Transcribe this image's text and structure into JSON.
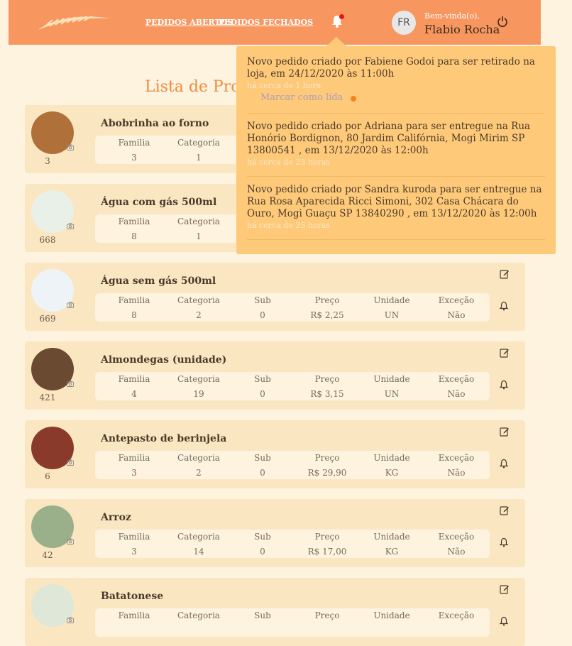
{
  "header": {
    "nav_open": "PEDIDOS ABERTOS",
    "nav_closed": "PEDIDOS FECHADOS",
    "avatar_initials": "FR",
    "welcome": "Bem-vinda(o),",
    "user_name": "Flabio Rocha"
  },
  "page": {
    "title": "Lista de Produtos"
  },
  "attr_labels": {
    "family": "Familia",
    "category": "Categoria",
    "sub": "Sub",
    "price": "Preço",
    "unit": "Unidade",
    "exception": "Exceção"
  },
  "products": [
    {
      "id": "3",
      "name": "Abobrinha ao forno",
      "family": "3",
      "category": "1",
      "sub": "",
      "price": "",
      "unit": "",
      "exception": ""
    },
    {
      "id": "668",
      "name": "Água com gás 500ml",
      "family": "8",
      "category": "1",
      "sub": "",
      "price": "",
      "unit": "",
      "exception": ""
    },
    {
      "id": "669",
      "name": "Água sem gás 500ml",
      "family": "8",
      "category": "2",
      "sub": "0",
      "price": "R$ 2,25",
      "unit": "UN",
      "exception": "Não"
    },
    {
      "id": "421",
      "name": "Almondegas (unidade)",
      "family": "4",
      "category": "19",
      "sub": "0",
      "price": "R$ 3,15",
      "unit": "UN",
      "exception": "Não"
    },
    {
      "id": "6",
      "name": "Antepasto de berinjela",
      "family": "3",
      "category": "2",
      "sub": "0",
      "price": "R$ 29,90",
      "unit": "KG",
      "exception": "Não"
    },
    {
      "id": "42",
      "name": "Arroz",
      "family": "3",
      "category": "14",
      "sub": "0",
      "price": "R$ 17,00",
      "unit": "KG",
      "exception": "Não"
    },
    {
      "id": "",
      "name": "Batatonese",
      "family": "",
      "category": "",
      "sub": "",
      "price": "",
      "unit": "",
      "exception": ""
    }
  ],
  "notifications": {
    "mark_read": "Marcar como lida",
    "items": [
      {
        "text": "Novo pedido criado por Fabiene Godoi para ser retirado na loja, em 24/12/2020 às 11:00h",
        "time": "há cerca de 1 hora"
      },
      {
        "text": "Novo pedido criado por Adriana para ser entregue na Rua Honório Bordignon, 80 Jardim Califórnia, Mogi Mirim SP 13800541 , em 13/12/2020 às 12:00h",
        "time": "há cerca de 23 horas"
      },
      {
        "text": "Novo pedido criado por Sandra kuroda para ser entregue na Rua Rosa Aparecida Ricci Simoni, 302 Casa Chácara do Ouro, Mogi Guaçu SP 13840290 , em 13/12/2020 às 12:00h",
        "time": "há cerca de 23 horas"
      }
    ]
  },
  "colors": {
    "header": "#f89660",
    "accent": "#f28a3c",
    "card": "#fbe6c2",
    "popup": "#ffc97a"
  },
  "icons": {
    "bell": "bell-icon",
    "power": "power-icon",
    "edit": "edit-icon",
    "camera": "camera-icon"
  }
}
